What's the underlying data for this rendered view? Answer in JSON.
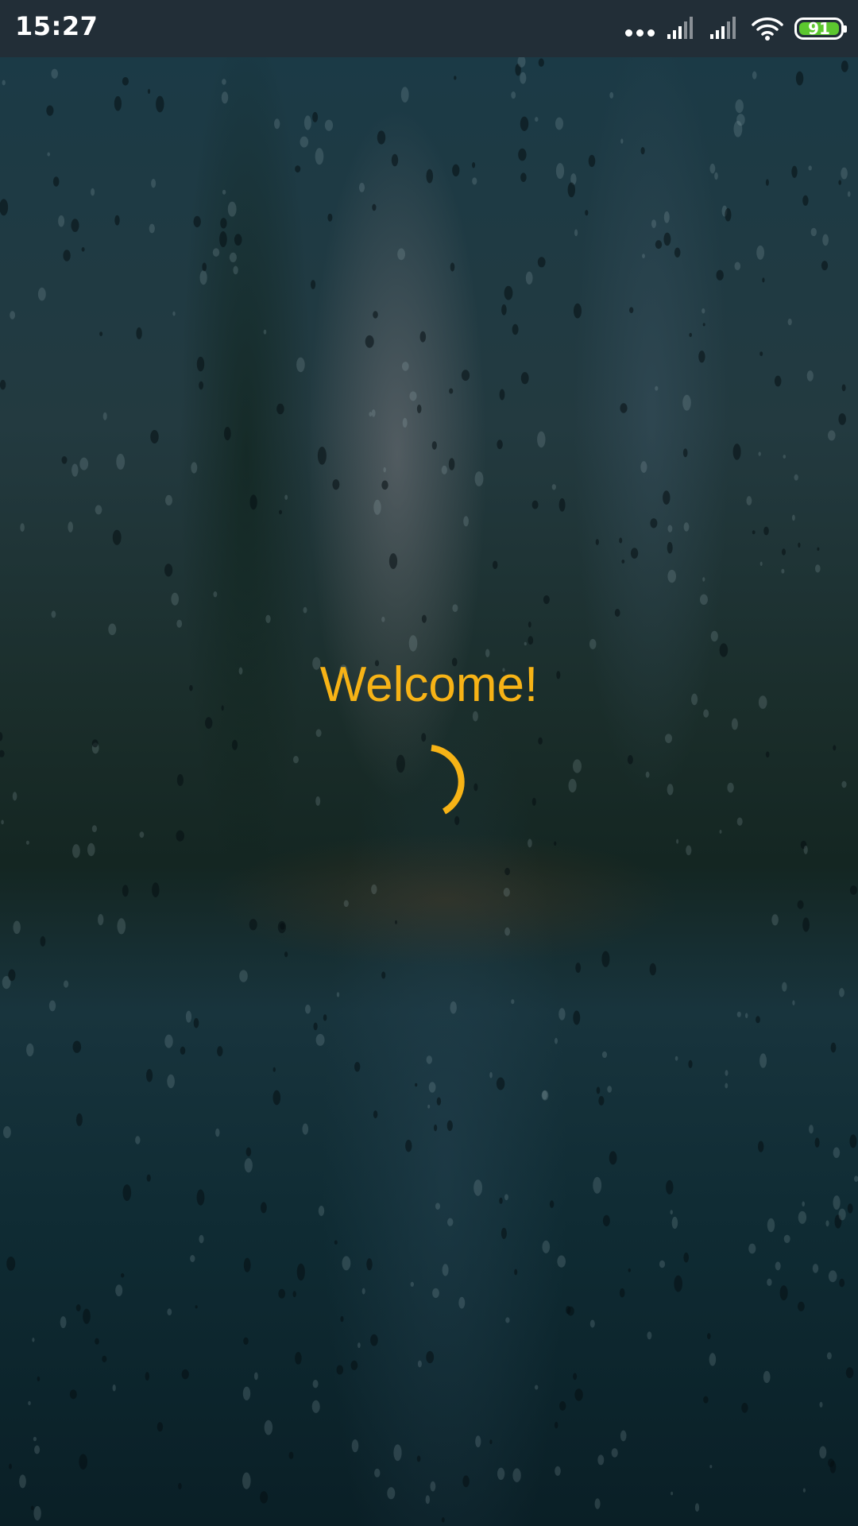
{
  "status_bar": {
    "time": "15:27",
    "battery_level": "91",
    "icons": [
      "more-dots-icon",
      "signal-icon",
      "signal-icon",
      "wifi-icon",
      "battery-icon"
    ]
  },
  "background": {
    "description_icon": "rain-window-background"
  },
  "splash": {
    "welcome_text": "Welcome!",
    "accent_color": "#f7b316",
    "loading_indicator": "spinner-icon"
  }
}
